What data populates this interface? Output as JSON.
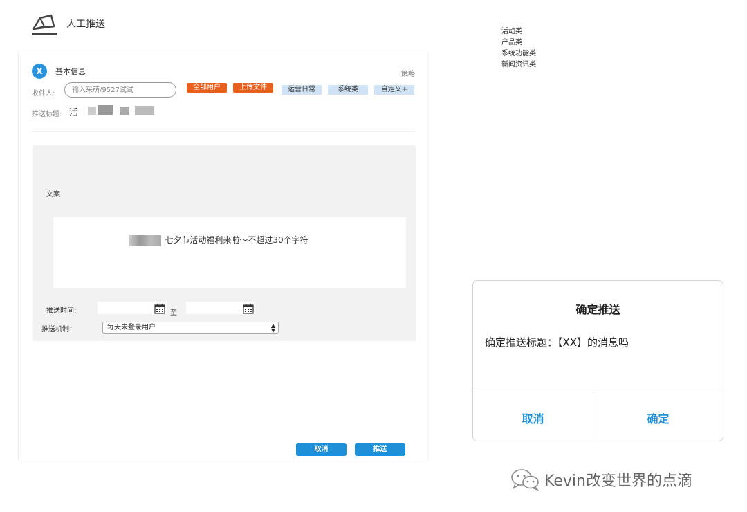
{
  "header": {
    "title": "人工推送"
  },
  "form": {
    "section_badge": "X",
    "section_title": "基本信息",
    "policy_link": "策略",
    "recipient_label": "收件人:",
    "recipient_placeholder": "输入采萌/9527试试",
    "tags": [
      {
        "label": "全部用户"
      },
      {
        "label": "上传文件"
      },
      {
        "label": "运营日常"
      },
      {
        "label": "系统类"
      },
      {
        "label": "自定义+"
      }
    ],
    "push_title_label": "推送标题:",
    "push_title_value": "活",
    "copy_label": "文案",
    "copy_text": "七夕节活动福利来啦～不超过30个字符",
    "push_time_label": "推送时间:",
    "time_separator": "至",
    "mechanism_label": "推送机制：",
    "mechanism_value": "每天未登录用户",
    "cancel_label": "取消",
    "push_label": "推送"
  },
  "category_list": [
    "活动类",
    "产品类",
    "系统功能类",
    "新闻资讯类"
  ],
  "dialog": {
    "title": "确定推送",
    "message": "确定推送标题：【XX】的消息吗",
    "cancel": "取消",
    "confirm": "确定"
  },
  "watermark": {
    "text": "Kevin改变世界的点滴"
  },
  "colors": {
    "accent": "#1d90d8",
    "tag_orange": "#e8601f",
    "tag_blue": "#cfe3f5",
    "badge": "#2a93df"
  }
}
